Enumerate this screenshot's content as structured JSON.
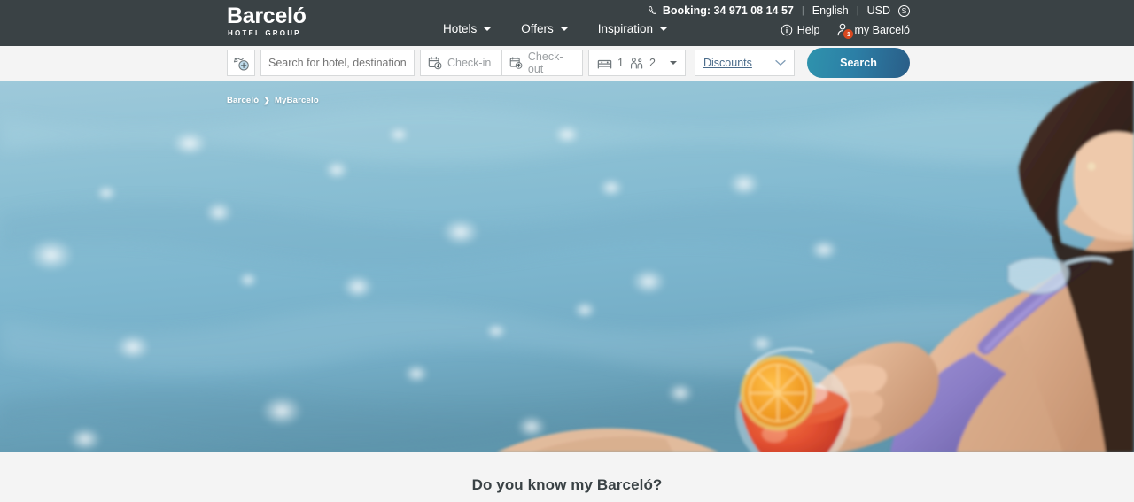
{
  "header": {
    "logo": {
      "main": "Barceló",
      "sub": "HOTEL GROUP"
    },
    "nav": [
      {
        "label": "Hotels",
        "icon": "chevron-down-icon"
      },
      {
        "label": "Offers",
        "icon": "chevron-down-icon"
      },
      {
        "label": "Inspiration",
        "icon": "chevron-down-icon"
      }
    ],
    "utility_top": {
      "phone_icon": "phone-icon",
      "booking": "Booking: 34 971 08 14 57",
      "separator": "|",
      "language": "English",
      "currency": "USD",
      "currency_symbol": "S"
    },
    "utility_bottom": {
      "help_icon": "info-circle-icon",
      "help": "Help",
      "account_icon": "person-icon",
      "account": "my Barceló",
      "account_badge": "1"
    }
  },
  "search": {
    "map_icon": "map-location-add-icon",
    "destination_placeholder": "Search for hotel, destination, the",
    "destination_value": "",
    "checkin_icon": "calendar-arrow-down-icon",
    "checkin_label": "Check-in",
    "checkout_icon": "calendar-arrow-up-icon",
    "checkout_label": "Check-out",
    "rooms_icon": "bed-icon",
    "rooms_value": "1",
    "guests_icon": "people-icon",
    "guests_value": "2",
    "occupancy_caret": "caret-down-icon",
    "discounts_label": "Discounts",
    "discounts_caret": "chevron-down-icon",
    "search_button": "Search"
  },
  "hero": {
    "breadcrumb": {
      "root": "Barceló",
      "separator": "❯",
      "current": "MyBarcelo"
    },
    "image_alt": "Woman in purple swimsuit by a pool holding an orange-garnished cocktail"
  },
  "bottom": {
    "title": "Do you know my Barceló?"
  },
  "colors": {
    "header_bg": "#3a4245",
    "strip_bg": "#f4f4f4",
    "badge": "#d9481f",
    "button_gradient_start": "#2f93ad",
    "button_gradient_end": "#2a5d87",
    "discount_link": "#4a6b8a",
    "text_dark": "#3a4245"
  }
}
